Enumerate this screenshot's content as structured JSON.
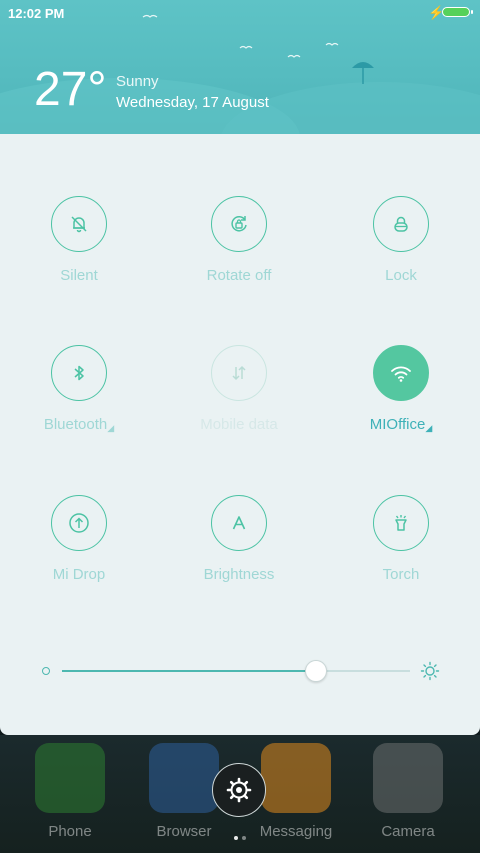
{
  "status_bar": {
    "time": "12:02 PM"
  },
  "weather": {
    "temperature": "27°",
    "condition": "Sunny",
    "date": "Wednesday, 17 August"
  },
  "toggles": [
    {
      "label": "Silent",
      "icon": "bell-off-icon",
      "state": "off"
    },
    {
      "label": "Rotate off",
      "icon": "rotate-lock-icon",
      "state": "off"
    },
    {
      "label": "Lock",
      "icon": "lock-icon",
      "state": "off"
    },
    {
      "label": "Bluetooth",
      "icon": "bluetooth-icon",
      "state": "off",
      "has_menu": true
    },
    {
      "label": "Mobile data",
      "icon": "mobile-data-icon",
      "state": "disabled"
    },
    {
      "label": "MIOffice",
      "icon": "wifi-icon",
      "state": "on",
      "has_menu": true
    },
    {
      "label": "Mi Drop",
      "icon": "mi-drop-icon",
      "state": "off"
    },
    {
      "label": "Brightness",
      "icon": "brightness-auto-icon",
      "state": "off"
    },
    {
      "label": "Torch",
      "icon": "torch-icon",
      "state": "off"
    }
  ],
  "brightness": {
    "level": 0.73
  },
  "dock": {
    "apps": [
      {
        "label": "Phone",
        "color": "#2e7d32"
      },
      {
        "label": "Browser",
        "color": "#2d5f9a"
      },
      {
        "label": "Messaging",
        "color": "#e08a1e"
      },
      {
        "label": "Camera",
        "color": "#6c6f70"
      }
    ]
  },
  "colors": {
    "accent": "#54c7a0",
    "header": "#56bcc0",
    "panel": "#eaf2f3"
  }
}
